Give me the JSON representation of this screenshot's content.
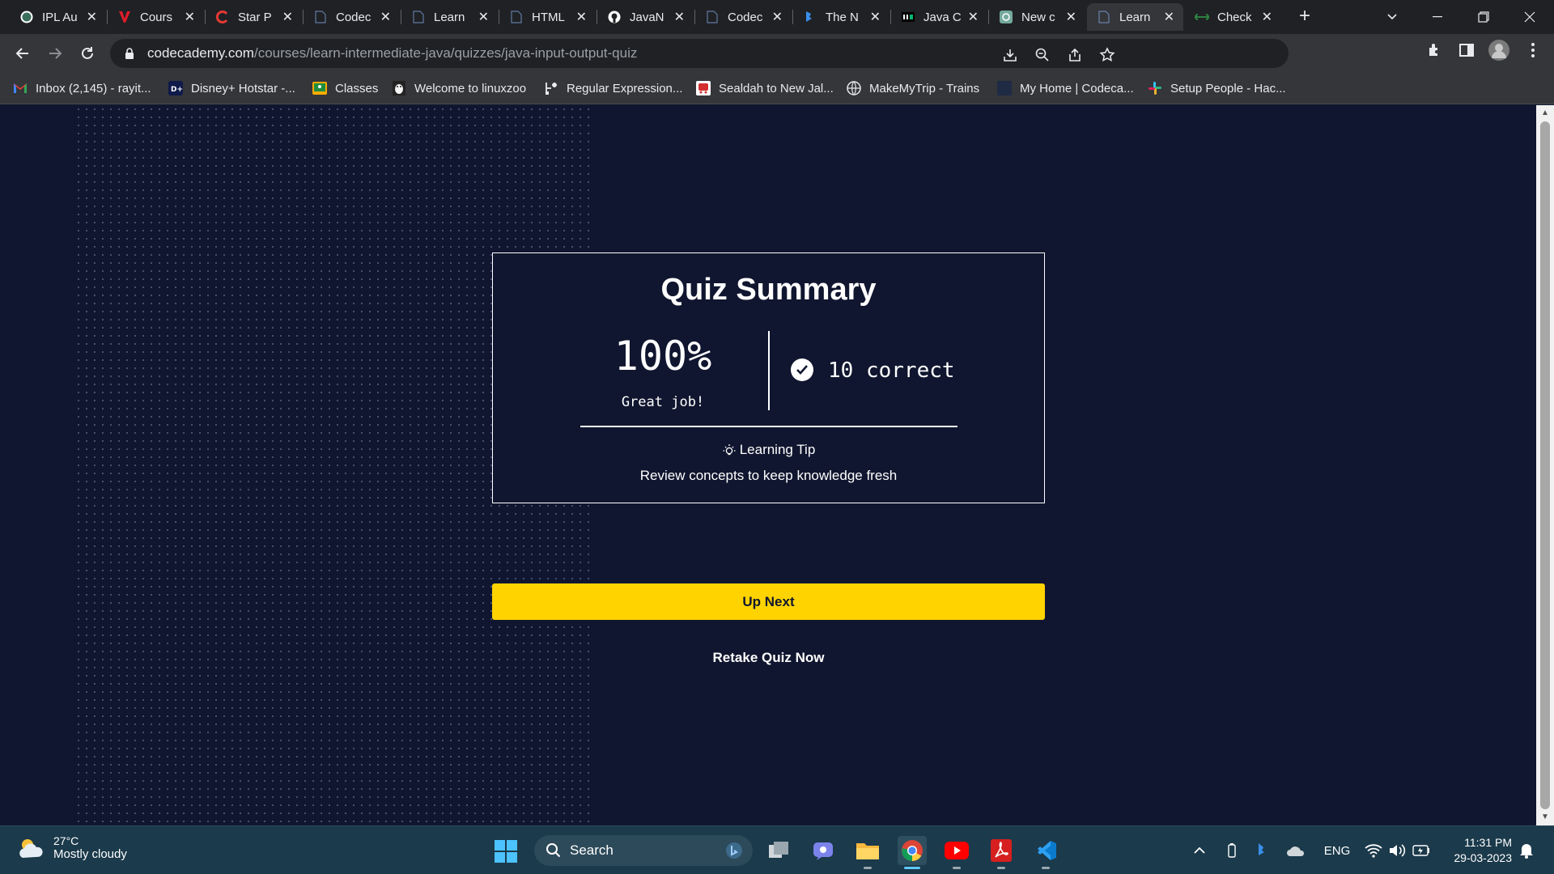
{
  "browser": {
    "tabs": [
      {
        "title": "IPL Au",
        "icon": "codechef-like-icon",
        "color": "#3c6e5c"
      },
      {
        "title": "Cours",
        "icon": "red-v-icon",
        "color": "#e11d2a"
      },
      {
        "title": "Star P",
        "icon": "red-c-icon",
        "color": "#e53935"
      },
      {
        "title": "Codec",
        "icon": "page-icon",
        "color": "#8ab4f8"
      },
      {
        "title": "Learn",
        "icon": "page-icon",
        "color": "#8ab4f8"
      },
      {
        "title": "HTML",
        "icon": "page-icon",
        "color": "#8ab4f8"
      },
      {
        "title": "JavaN",
        "icon": "github-icon",
        "color": "#ffffff"
      },
      {
        "title": "Codec",
        "icon": "page-icon",
        "color": "#8ab4f8"
      },
      {
        "title": "The N",
        "icon": "bing-icon",
        "color": "#3b8eea"
      },
      {
        "title": "Java C",
        "icon": "hackerrank-like-icon",
        "color": "#ffffff"
      },
      {
        "title": "New c",
        "icon": "chatgpt-icon",
        "color": "#74aa9c"
      },
      {
        "title": "Learn",
        "icon": "page-icon",
        "color": "#8ab4f8"
      },
      {
        "title": "Check",
        "icon": "gfg-icon",
        "color": "#2f8d46"
      }
    ],
    "active_tab_index": 11,
    "url_host": "codecademy.com",
    "url_path": "/courses/learn-intermediate-java/quizzes/java-input-output-quiz",
    "bookmarks": [
      {
        "label": "Inbox (2,145) - rayit...",
        "icon": "gmail-icon"
      },
      {
        "label": "Disney+ Hotstar -...",
        "icon": "hotstar-icon"
      },
      {
        "label": "Classes",
        "icon": "classroom-icon"
      },
      {
        "label": "Welcome to linuxzoo",
        "icon": "linuxzoo-icon"
      },
      {
        "label": "Regular Expression...",
        "icon": "regex-icon"
      },
      {
        "label": "Sealdah to New Jal...",
        "icon": "train-icon"
      },
      {
        "label": "MakeMyTrip - Trains",
        "icon": "globe-icon"
      },
      {
        "label": "My Home | Codeca...",
        "icon": "codecademy-icon"
      },
      {
        "label": "Setup People - Hac...",
        "icon": "slack-icon"
      }
    ]
  },
  "quiz": {
    "title": "Quiz Summary",
    "score": "100%",
    "score_caption": "Great job!",
    "correct_text": "10 correct",
    "tip_heading": "Learning Tip",
    "tip_text": "Review concepts to keep knowledge fresh",
    "up_next_label": "Up Next",
    "retake_label": "Retake Quiz Now"
  },
  "colors": {
    "page_bg": "#10162f",
    "accent_yellow": "#ffd300",
    "text": "#ffffff"
  },
  "taskbar": {
    "weather_temp": "27°C",
    "weather_condition": "Mostly cloudy",
    "search_label": "Search",
    "language": "ENG",
    "time": "11:31 PM",
    "date": "29-03-2023"
  }
}
